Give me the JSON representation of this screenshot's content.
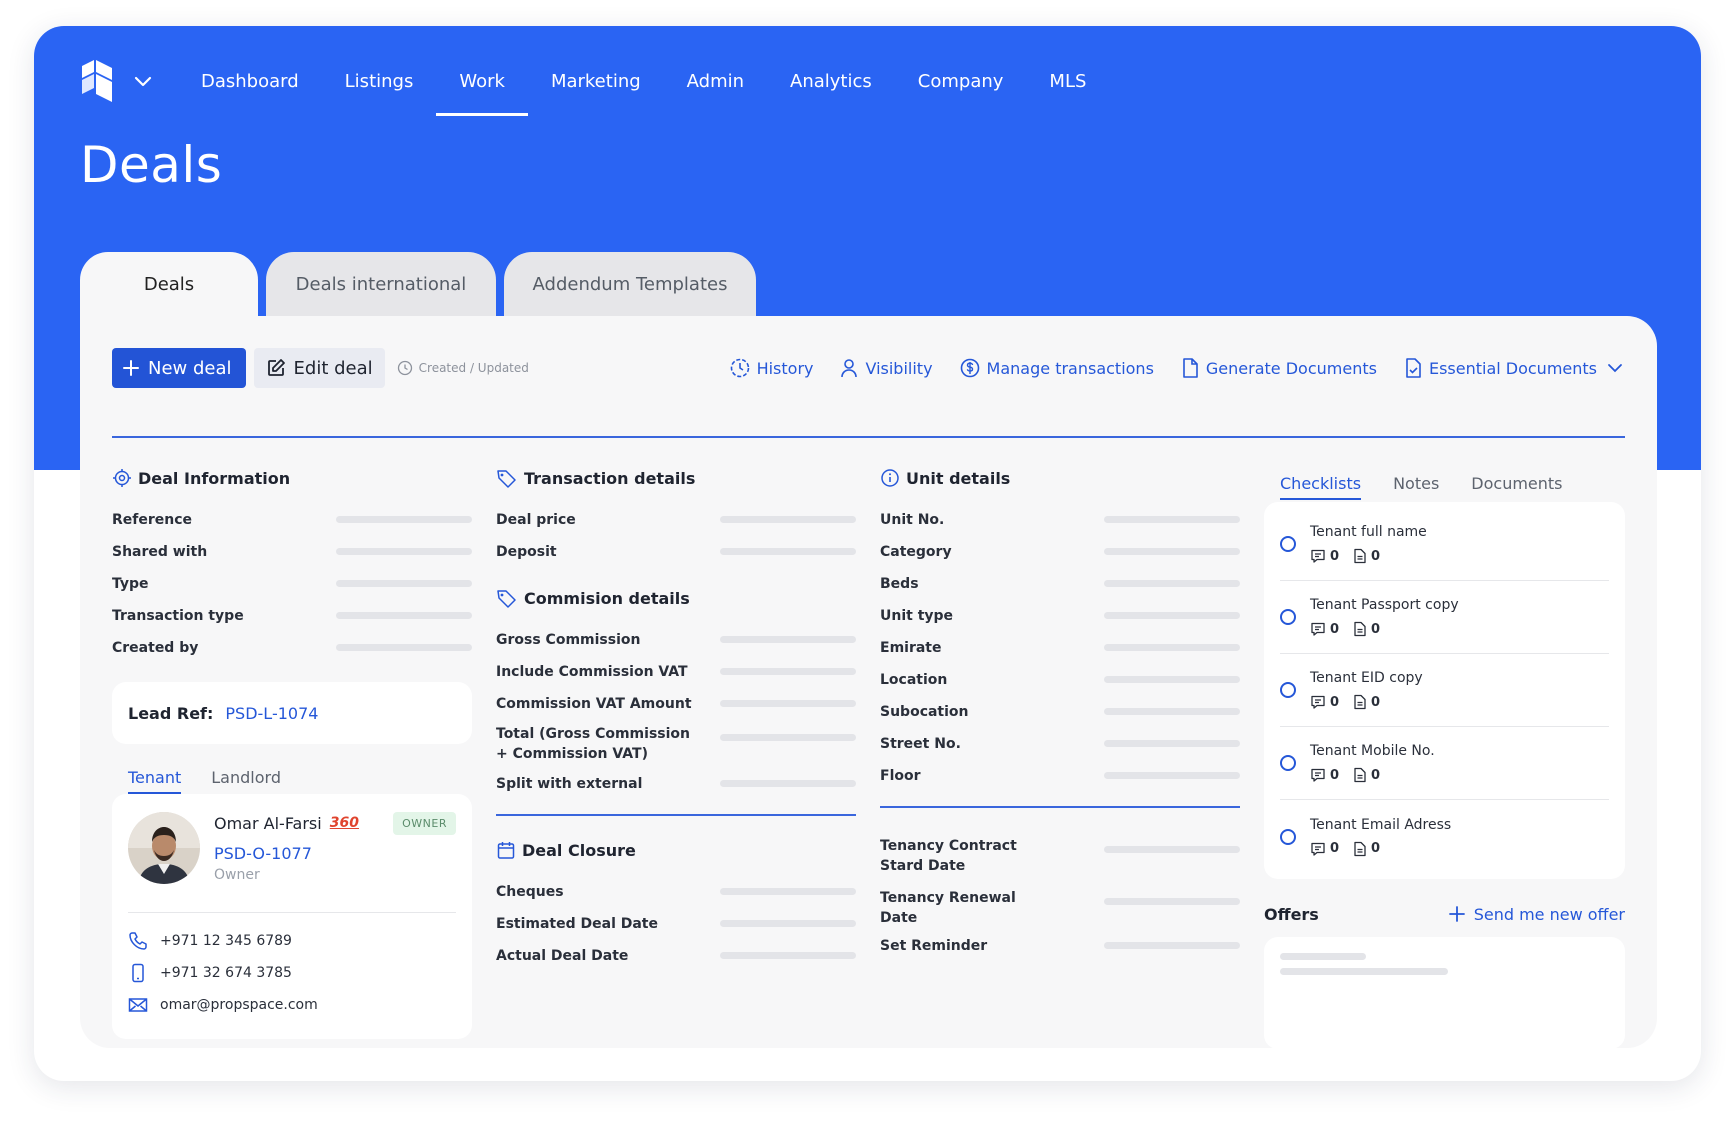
{
  "nav": {
    "items": [
      "Dashboard",
      "Listings",
      "Work",
      "Marketing",
      "Admin",
      "Analytics",
      "Company",
      "MLS"
    ],
    "active": "Work"
  },
  "page": {
    "title": "Deals"
  },
  "tabs": [
    "Deals",
    "Deals international",
    "Addendum Templates"
  ],
  "toolbar": {
    "new_deal": "New deal",
    "edit_deal": "Edit deal",
    "meta": "Created / Updated",
    "actions": [
      "History",
      "Visibility",
      "Manage transactions",
      "Generate Documents",
      "Essential Documents"
    ]
  },
  "deal_info": {
    "title": "Deal Information",
    "fields": [
      "Reference",
      "Shared with",
      "Type",
      "Transaction type",
      "Created by"
    ],
    "lead_ref_label": "Lead Ref:",
    "lead_ref_value": "PSD-L-1074"
  },
  "parties": {
    "tabs": [
      "Tenant",
      "Landlord"
    ],
    "contact": {
      "name": "Omar Al-Farsi",
      "badge360": "360",
      "id": "PSD-O-1077",
      "role": "Owner",
      "tag": "OWNER",
      "phone": "+971 12 345 6789",
      "mobile": "+971 32 674 3785",
      "email": "omar@propspace.com"
    }
  },
  "transaction": {
    "title": "Transaction details",
    "fields": [
      "Deal price",
      "Deposit"
    ],
    "commission_title": "Commision details",
    "commission_fields": [
      "Gross Commission",
      "Include Commission VAT",
      "Commission VAT Amount",
      "Total (Gross Commission + Commission VAT)",
      "Split with external"
    ],
    "closure_title": "Deal Closure",
    "closure_fields": [
      "Cheques",
      "Estimated Deal Date",
      "Actual Deal Date"
    ]
  },
  "unit": {
    "title": "Unit details",
    "fields": [
      "Unit No.",
      "Category",
      "Beds",
      "Unit type",
      "Emirate",
      "Location",
      "Subocation",
      "Street No.",
      "Floor"
    ],
    "tenancy_fields": [
      "Tenancy Contract Stard Date",
      "Tenancy Renewal Date",
      "Set Reminder"
    ]
  },
  "right": {
    "tabs": [
      "Checklists",
      "Notes",
      "Documents"
    ],
    "checklist": [
      {
        "title": "Tenant full name",
        "comments": "0",
        "docs": "0"
      },
      {
        "title": "Tenant Passport copy",
        "comments": "0",
        "docs": "0"
      },
      {
        "title": "Tenant EID copy",
        "comments": "0",
        "docs": "0"
      },
      {
        "title": "Tenant Mobile No.",
        "comments": "0",
        "docs": "0"
      },
      {
        "title": "Tenant Email Adress",
        "comments": "0",
        "docs": "0"
      }
    ],
    "offers_title": "Offers",
    "offers_action": "Send me new offer"
  },
  "colors": {
    "brand": "#2a64f3",
    "primary_button": "#2354d6",
    "link": "#2557d8",
    "badge360": "#e0442e",
    "owner_badge_bg": "#e3f5e8"
  }
}
